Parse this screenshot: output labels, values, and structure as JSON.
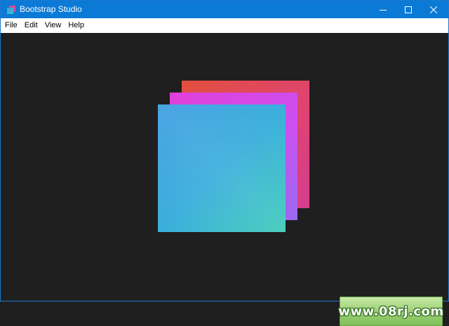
{
  "window": {
    "title": "Bootstrap Studio",
    "app_icon": "bootstrap-studio-icon",
    "controls": {
      "minimize_icon": "minimize-icon",
      "maximize_icon": "maximize-icon",
      "close_icon": "close-icon"
    }
  },
  "menubar": {
    "items": [
      {
        "label": "File"
      },
      {
        "label": "Edit"
      },
      {
        "label": "View"
      },
      {
        "label": "Help"
      }
    ]
  },
  "splash": {
    "logo_icon": "bootstrap-studio-logo"
  },
  "watermark": {
    "text": "www.08rj.com"
  },
  "colors": {
    "titlebar": "#0b7ad6",
    "content_bg": "#1f1f20",
    "logo_back": "#e0456a",
    "logo_middle": "#d24be8",
    "logo_front": "#36a6d8"
  }
}
